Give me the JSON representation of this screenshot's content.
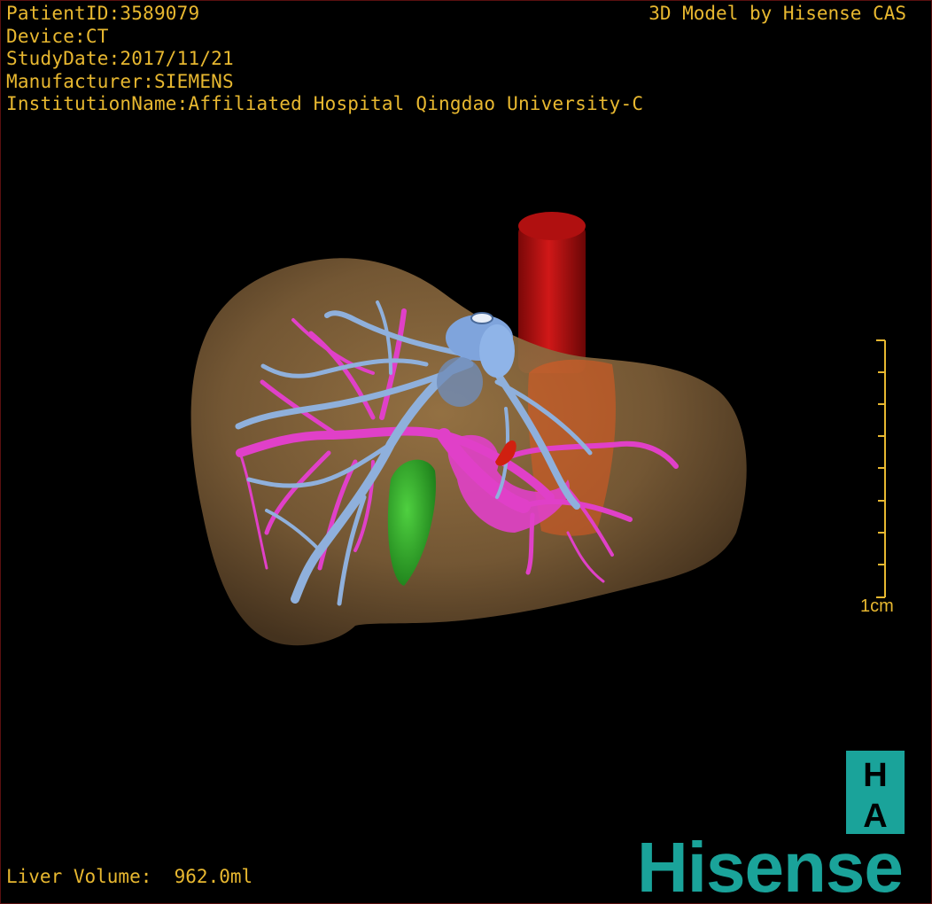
{
  "header": {
    "patient_id": "PatientID:3589079",
    "device": "Device:CT",
    "study_date": "StudyDate:2017/11/21",
    "manufacturer": "Manufacturer:SIEMENS",
    "institution": "InstitutionName:Affiliated Hospital Qingdao University-C",
    "credit": "3D Model by Hisense CAS"
  },
  "footer": {
    "liver_volume": "Liver Volume:  962.0ml"
  },
  "scale_bar": {
    "label": "1cm",
    "tick_count": 9
  },
  "logos": {
    "ha_top": "H",
    "ha_bottom": "A",
    "brand": "Hisense"
  },
  "colors": {
    "text": "#e8b830",
    "liver": "#8a6a40",
    "portal_vein": "#e040c8",
    "hepatic_vein": "#8fb0dc",
    "aorta": "#c01010",
    "gallbladder": "#2fb02a",
    "ivc": "#e05a20",
    "brand": "#1aa39a"
  },
  "icons": {
    "ha": "ha-logo-icon",
    "brand": "hisense-logo-icon"
  }
}
